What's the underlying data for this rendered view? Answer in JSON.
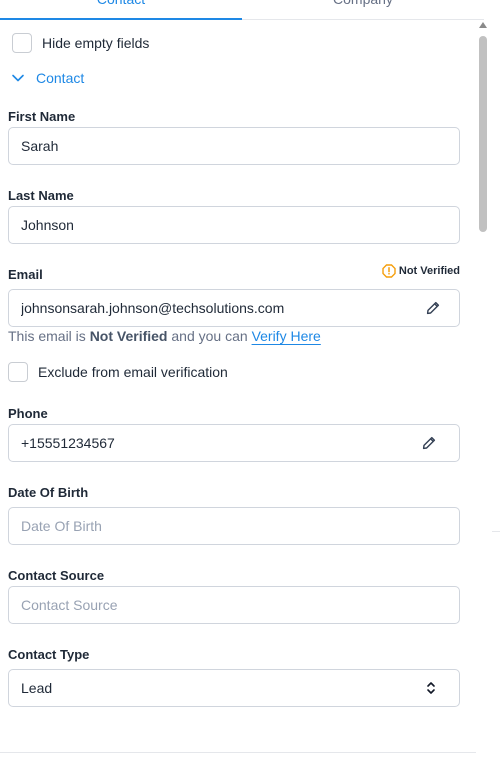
{
  "tabs": [
    {
      "label": "Contact",
      "active": true
    },
    {
      "label": "Company",
      "active": false
    }
  ],
  "hide_empty": {
    "label": "Hide empty fields",
    "checked": false
  },
  "section": {
    "label": "Contact",
    "expanded": true
  },
  "fields": {
    "first_name": {
      "label": "First Name",
      "value": "Sarah"
    },
    "last_name": {
      "label": "Last Name",
      "value": "Johnson"
    },
    "email": {
      "label": "Email",
      "value": "johnsonsarah.johnson@techsolutions.com",
      "status": "Not Verified",
      "note_prefix": "This email is",
      "note_status": "Not Verified",
      "note_middle": "and you can",
      "note_link": "Verify Here"
    },
    "exclude_verification": {
      "label": "Exclude from email verification",
      "checked": false
    },
    "phone": {
      "label": "Phone",
      "value": "+15551234567"
    },
    "dob": {
      "label": "Date Of Birth",
      "placeholder": "Date Of Birth"
    },
    "contact_source": {
      "label": "Contact Source",
      "placeholder": "Contact Source"
    },
    "contact_type": {
      "label": "Contact Type",
      "value": "Lead"
    }
  },
  "colors": {
    "accent": "#1e88e5",
    "warning": "#f59e0b",
    "border": "#d0d5dd"
  },
  "icons": {
    "edit": "pencil-icon",
    "warning": "warning-octagon-icon",
    "chevron": "chevron-down-icon",
    "select": "up-down-chevron-icon"
  }
}
